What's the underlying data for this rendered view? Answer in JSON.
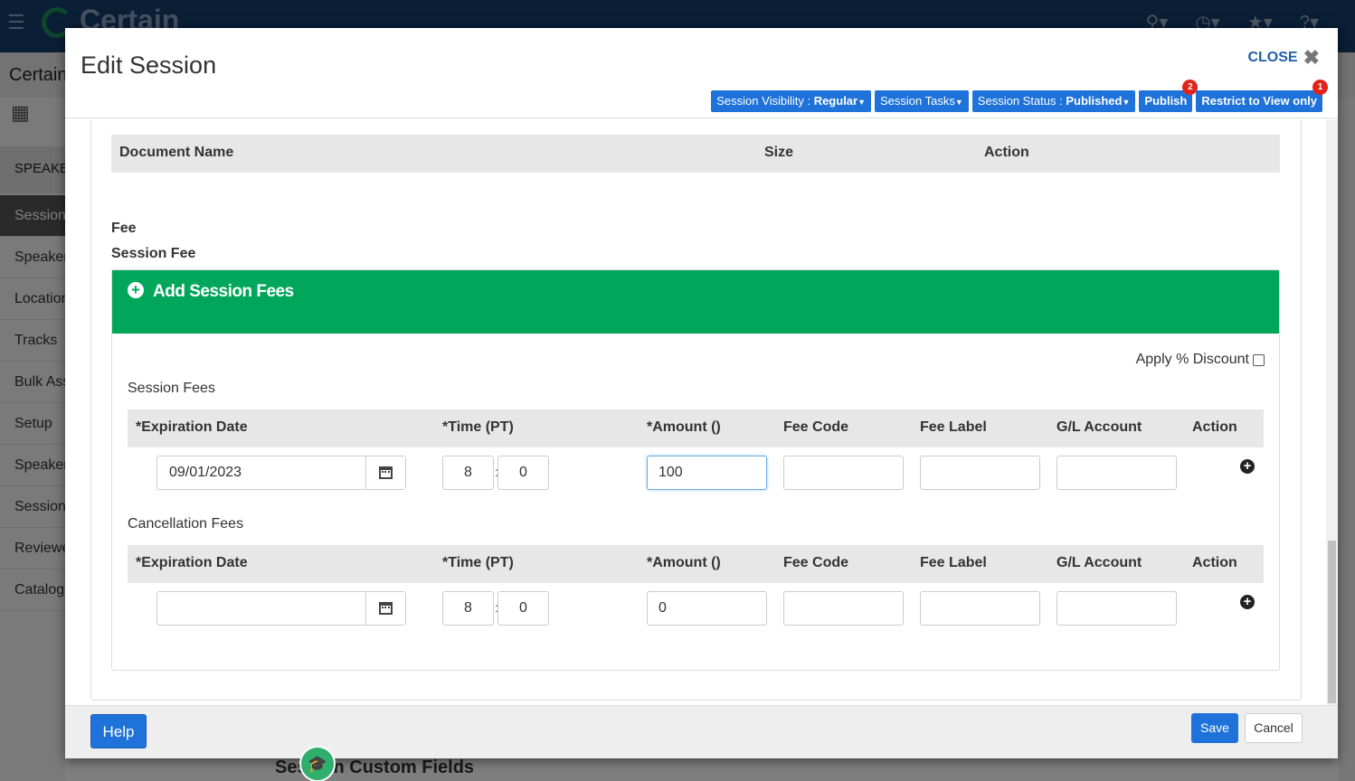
{
  "background": {
    "logo_text": "Certain",
    "subtitle": "Certain",
    "sidebar_header": "SPEAKE",
    "nav_items": [
      "Sessions",
      "Speakers",
      "Locations",
      "Tracks",
      "Bulk Ass",
      "Setup",
      "Speaker",
      "Session",
      "Reviewe",
      "Catalog"
    ],
    "bottom_text": "Session Custom Fields"
  },
  "modal": {
    "title": "Edit Session",
    "close_label": "CLOSE",
    "header_buttons": {
      "visibility_prefix": "Session Visibility : ",
      "visibility_value": "Regular",
      "tasks": "Session Tasks",
      "status_prefix": "Session Status : ",
      "status_value": "Published",
      "publish": "Publish",
      "publish_badge": "2",
      "restrict": "Restrict to View only",
      "restrict_badge": "1"
    },
    "documents_table": {
      "columns": [
        "Document Name",
        "Size",
        "Action"
      ]
    },
    "fee_heading": "Fee",
    "session_fee_heading": "Session Fee",
    "add_fees_title": "Add Session Fees",
    "apply_discount_label": "Apply % Discount",
    "apply_discount_checked": false,
    "fee_columns": [
      "*Expiration Date",
      "*Time (PT)",
      "*Amount ()",
      "Fee Code",
      "Fee Label",
      "G/L Account",
      "Action"
    ],
    "session_fees": {
      "label": "Session Fees",
      "row": {
        "expiration_date": "09/01/2023",
        "hour": "8",
        "minute": "0",
        "amount": "100",
        "fee_code": "",
        "fee_label": "",
        "gl_account": ""
      }
    },
    "cancellation_fees": {
      "label": "Cancellation Fees",
      "row": {
        "expiration_date": "",
        "hour": "8",
        "minute": "0",
        "amount": "0",
        "fee_code": "",
        "fee_label": "",
        "gl_account": ""
      }
    },
    "footer": {
      "help": "Help",
      "save": "Save",
      "cancel": "Cancel"
    }
  },
  "colors": {
    "primary": "#1e72d9",
    "success_bar": "#00a65a",
    "badge": "#e2231a",
    "topbar": "#143c6d"
  }
}
